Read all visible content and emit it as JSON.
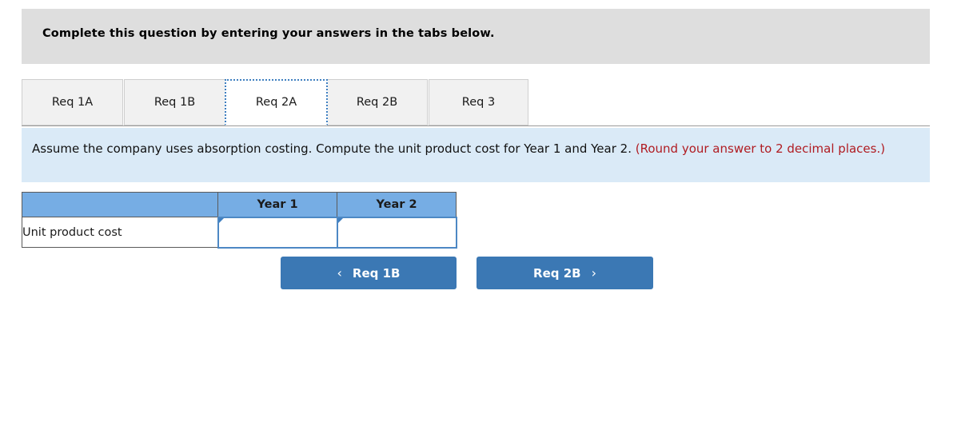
{
  "header": {
    "title": "Complete this question by entering your answers in the tabs below."
  },
  "tabs": [
    {
      "id": "req-1a",
      "label": "Req 1A",
      "active": false
    },
    {
      "id": "req-1b",
      "label": "Req 1B",
      "active": false
    },
    {
      "id": "req-2a",
      "label": "Req 2A",
      "active": true
    },
    {
      "id": "req-2b",
      "label": "Req 2B",
      "active": false
    },
    {
      "id": "req-3",
      "label": "Req 3",
      "active": false
    }
  ],
  "instruction": {
    "main": "Assume the company uses absorption costing. Compute the unit product cost for Year 1 and Year 2. ",
    "note": "(Round your answer to 2 decimal places.)"
  },
  "table": {
    "headers": [
      "",
      "Year 1",
      "Year 2"
    ],
    "rows": [
      {
        "label": "Unit product cost",
        "values": [
          "",
          ""
        ],
        "placeholders": [
          "",
          ""
        ]
      }
    ]
  },
  "nav": {
    "prev": {
      "label": "Req 1B",
      "icon": "chevron-left-icon",
      "glyph": "‹"
    },
    "next": {
      "label": "Req 2B",
      "icon": "chevron-right-icon",
      "glyph": "›"
    }
  },
  "colors": {
    "header_bg": "#dedede",
    "panel_bg": "#daeaf7",
    "note_red": "#b01c22",
    "table_header_blue": "#76ade4",
    "button_blue": "#3b78b4",
    "input_border_blue": "#4d88c4",
    "tab_bg": "#f1f1f1",
    "focus_outline": "#3f7fc0"
  }
}
